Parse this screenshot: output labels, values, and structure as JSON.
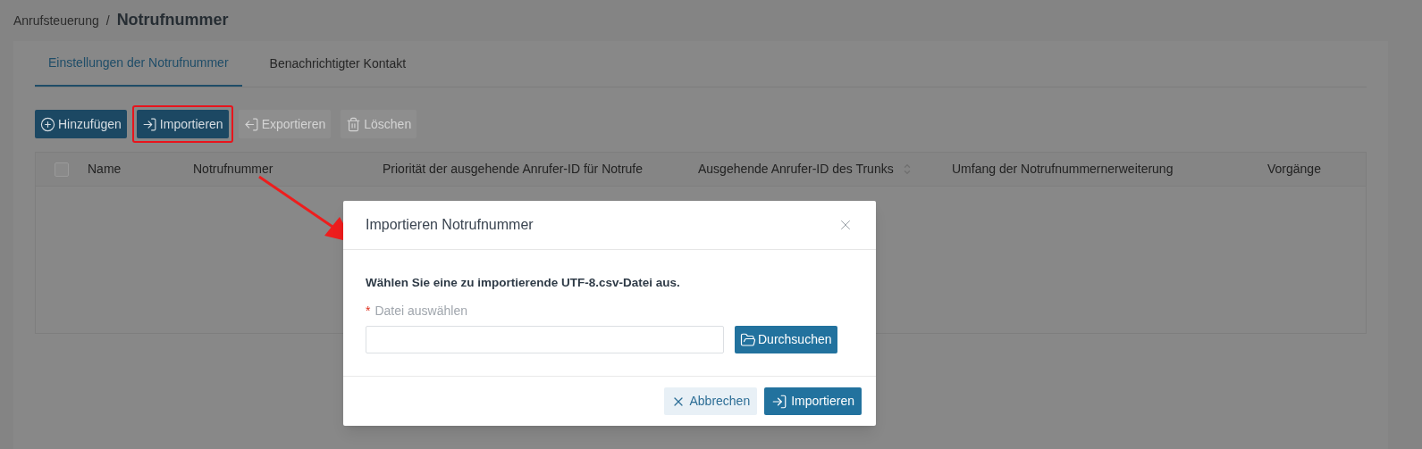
{
  "breadcrumb": {
    "parent": "Anrufsteuerung",
    "separator": "/",
    "current": "Notrufnummer"
  },
  "tabs": [
    {
      "label": "Einstellungen der Notrufnummer",
      "selected": true
    },
    {
      "label": "Benachrichtigter Kontakt",
      "selected": false
    }
  ],
  "toolbar": [
    {
      "label": "Hinzufügen",
      "kind": "add",
      "disabled": false,
      "highlighted": false
    },
    {
      "label": "Importieren",
      "kind": "import",
      "disabled": false,
      "highlighted": true
    },
    {
      "label": "Exportieren",
      "kind": "export",
      "disabled": true,
      "highlighted": false
    },
    {
      "label": "Löschen",
      "kind": "delete",
      "disabled": true,
      "highlighted": false
    }
  ],
  "table": {
    "select_all": {
      "checked": false
    },
    "columns": [
      {
        "label": "Name",
        "sortable": false
      },
      {
        "label": "Notrufnummer",
        "sortable": false
      },
      {
        "label": "Priorität der ausgehende Anrufer-ID für Notrufe",
        "sortable": false
      },
      {
        "label": "Ausgehende Anrufer-ID des Trunks",
        "sortable": true
      },
      {
        "label": "Umfang der Notrufnummernerweiterung",
        "sortable": false
      },
      {
        "label": "Vorgänge",
        "sortable": false
      }
    ]
  },
  "dialog": {
    "title": "Importieren Notrufnummer",
    "instruction": "Wählen Sie eine zu importierende UTF-8.csv-Datei aus.",
    "field": {
      "label": "Datei auswählen",
      "required_mark": "*",
      "button": "Durchsuchen"
    },
    "buttons": [
      {
        "label": "Abbrechen",
        "kind": "cancel"
      },
      {
        "label": "Importieren",
        "kind": "import"
      }
    ]
  }
}
